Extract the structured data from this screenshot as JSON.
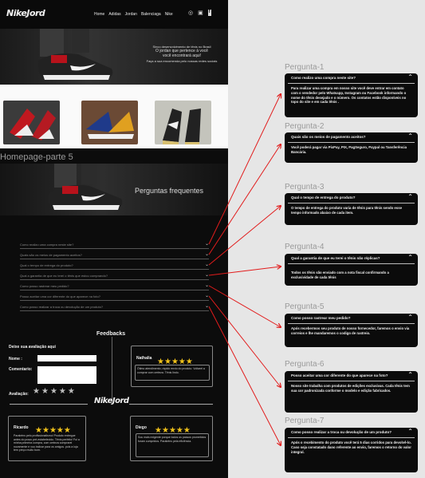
{
  "nav": {
    "logo": "NikeJord",
    "links": [
      "Home",
      "Adidas",
      "Jordan",
      "Balenciaga",
      "Nike"
    ],
    "icons": [
      "whatsapp-icon",
      "instagram-icon",
      "facebook-icon"
    ]
  },
  "hero1": {
    "line1": "Sinco desenvolvimento de tênis no Brasil",
    "line2": "O jordan que pertence à você",
    "line3": "você encontrará aqui!",
    "line4": "Faça a sua encomenda pelo nossas redes sociais"
  },
  "section_label": "Homepage-parte 5",
  "hero2": {
    "title": "Perguntas frequentes"
  },
  "faq": [
    "Como realizo uma compra neste site?",
    "Quais são os meios de pagamento aceitos?",
    "Qual o tempo de entrega do produto?",
    "Qual a garantia de que eu terei o tênis que estou comprando?",
    "Como posso rastrear meu pedido?",
    "Posso aceitar uma cor diferente do que aparece na foto?",
    "Como posso realizar a troca ou devolução de um produto?"
  ],
  "feedbacks": {
    "title": "Feedbacks",
    "form_title": "Deixe sua avaliação aqui",
    "name_label": "Nome :",
    "comment_label": "Comentario:",
    "rating_label": "Avaliação:",
    "reviews": [
      {
        "name": "Nathalia",
        "text": "Ótimo atendimento, rápido envio do produto. Voltarei a comprar com certeza. Tênis lindo.",
        "stars": 5
      },
      {
        "name": "Ricardo",
        "text": "Parabéns pelo profissionalismo! Produto entregue antes do prazo pré-estabelecido. Tênis perfeito! Fui a minha primeira compra, com certeza comprarei novamente e vou indicar para os amigos. pois a loja tem preço muito bom.",
        "stars": 5
      },
      {
        "name": "Diego",
        "text": "Sou mais exigente porque todos os passos prometidos foram cumpridos. Parabéns pela eficiência.",
        "stars": 5
      }
    ]
  },
  "cards": [
    {
      "label": "Pergunta-1",
      "q": "Como realizo uma compra neste site?",
      "a": "Para realizar uma compra em nosso site você deve entrar em contato com o vendedor pelo Whatsapp, Instagram ou Facebook informando o nome do tênis desejado e o número. Os contatos estão disponíveis no topo do site e em cada tênis ."
    },
    {
      "label": "Pergunta-2",
      "q": "Quais são os meios de pagamento aceitos?",
      "a": "Você poderá pagar via PixPay, PIX, PagSeguro, Paypal ou Tansferência Bancária."
    },
    {
      "label": "Pergunta-3",
      "q": "Qual o tempo de entrega do produto?",
      "a": "O tempo de entrega do produto varia de tênis para tênis sendo esse tempo informado abaixo de cada item."
    },
    {
      "label": "Pergunta-4",
      "q": "Qual a garantia de que eu terei o tênis não réplicas?",
      "a": "Todos  os tênis são enviado com a nota fiscal confirmando a exclusividade de cada tênis"
    },
    {
      "label": "Pergunta-5",
      "q": "Como posso rastrear meu pedido?",
      "a": "Após recebermos seu produto de nosso fornecedor, faremos o envio via correios e lhe mandaremos o codigo de rastreio."
    },
    {
      "label": "Pergunta-6",
      "q": "Posso aceitar uma cor diferente do  que aparece na foto?",
      "a": "Nosso site trabalha com produtos de edições exclusivas. Cada tênis tem sua cor padronizada conforme o modelo e edição fabricados."
    },
    {
      "label": "Pergunta-7",
      "q": "Como posso realizar a troca ou devolução de um produto?",
      "a": "Após o recebimento do produto você terá 5 dias corridos  para devolvê-lo. Caso seja constatado dano referente ao envio, faremos o retorno do valor integral."
    }
  ],
  "colors": {
    "arrow": "#e21c1c",
    "star": "#f2c31a",
    "card_bg": "#0b0b0b",
    "page_bg": "#e6e6e6"
  }
}
